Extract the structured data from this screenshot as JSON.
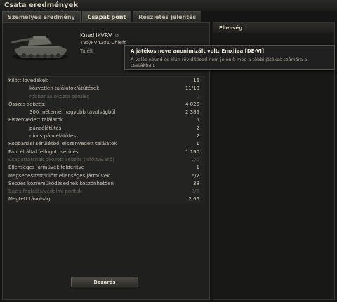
{
  "window": {
    "title": "Csata eredmények"
  },
  "tabs": [
    {
      "label": "Személyes eredmény"
    },
    {
      "label": "Csapat pont"
    },
    {
      "label": "Részletes jelentés"
    }
  ],
  "player": {
    "name": "KnedlikVRV",
    "tank": "T95/FV4201 Chieft",
    "status": "Túlélt"
  },
  "stats": [
    {
      "label": "Kilőtt lövedékek",
      "value": "16",
      "sub": false,
      "dim": false
    },
    {
      "label": "közvetlen találatok/átütések",
      "value": "11/10",
      "sub": true,
      "dim": false
    },
    {
      "label": "robbanás okozta sérülés",
      "value": "0",
      "sub": true,
      "dim": true
    },
    {
      "label": "Összes sebzés:",
      "value": "4 025",
      "sub": false,
      "dim": false
    },
    {
      "label": "300 méternél nagyobb távolságból",
      "value": "2 385",
      "sub": true,
      "dim": false
    },
    {
      "label": "Elszenvedett találatok",
      "value": "5",
      "sub": false,
      "dim": false
    },
    {
      "label": "páncélátütés",
      "value": "2",
      "sub": true,
      "dim": false
    },
    {
      "label": "nincs páncélátütés",
      "value": "2",
      "sub": true,
      "dim": false
    },
    {
      "label": "Robbanási sérülésből elszenvedett találatok",
      "value": "1",
      "sub": false,
      "dim": false
    },
    {
      "label": "Páncél által felfogott sérülés",
      "value": "1 190",
      "sub": false,
      "dim": false
    },
    {
      "label": "Csapattársnak okozott sebzés (kilőtt/É.erő)",
      "value": "0/0",
      "sub": false,
      "dim": true
    },
    {
      "label": "Ellenséges járművek felderítve",
      "value": "1",
      "sub": false,
      "dim": false
    },
    {
      "label": "Megsebesített/kilőtt ellenséges járművek",
      "value": "6/2",
      "sub": false,
      "dim": false
    },
    {
      "label": "Sebzés közreműködésednek köszönhetően",
      "value": "38",
      "sub": false,
      "dim": false
    },
    {
      "label": "Bázis foglalás/védelmi pontok",
      "value": "0/0",
      "sub": false,
      "dim": true
    },
    {
      "label": "Megtett távolság",
      "value": "2,66",
      "sub": false,
      "dim": false
    }
  ],
  "buttons": {
    "close": "Bezárás"
  },
  "enemy_panel": {
    "title": "Ellenség"
  },
  "tooltip": {
    "title": "A játékos neve anonimizált volt: Emxliaa [DE-VI]",
    "body": "A valós neved és klán rövidítésed nem jelenik meg a többi játékos számára a csatákban."
  }
}
